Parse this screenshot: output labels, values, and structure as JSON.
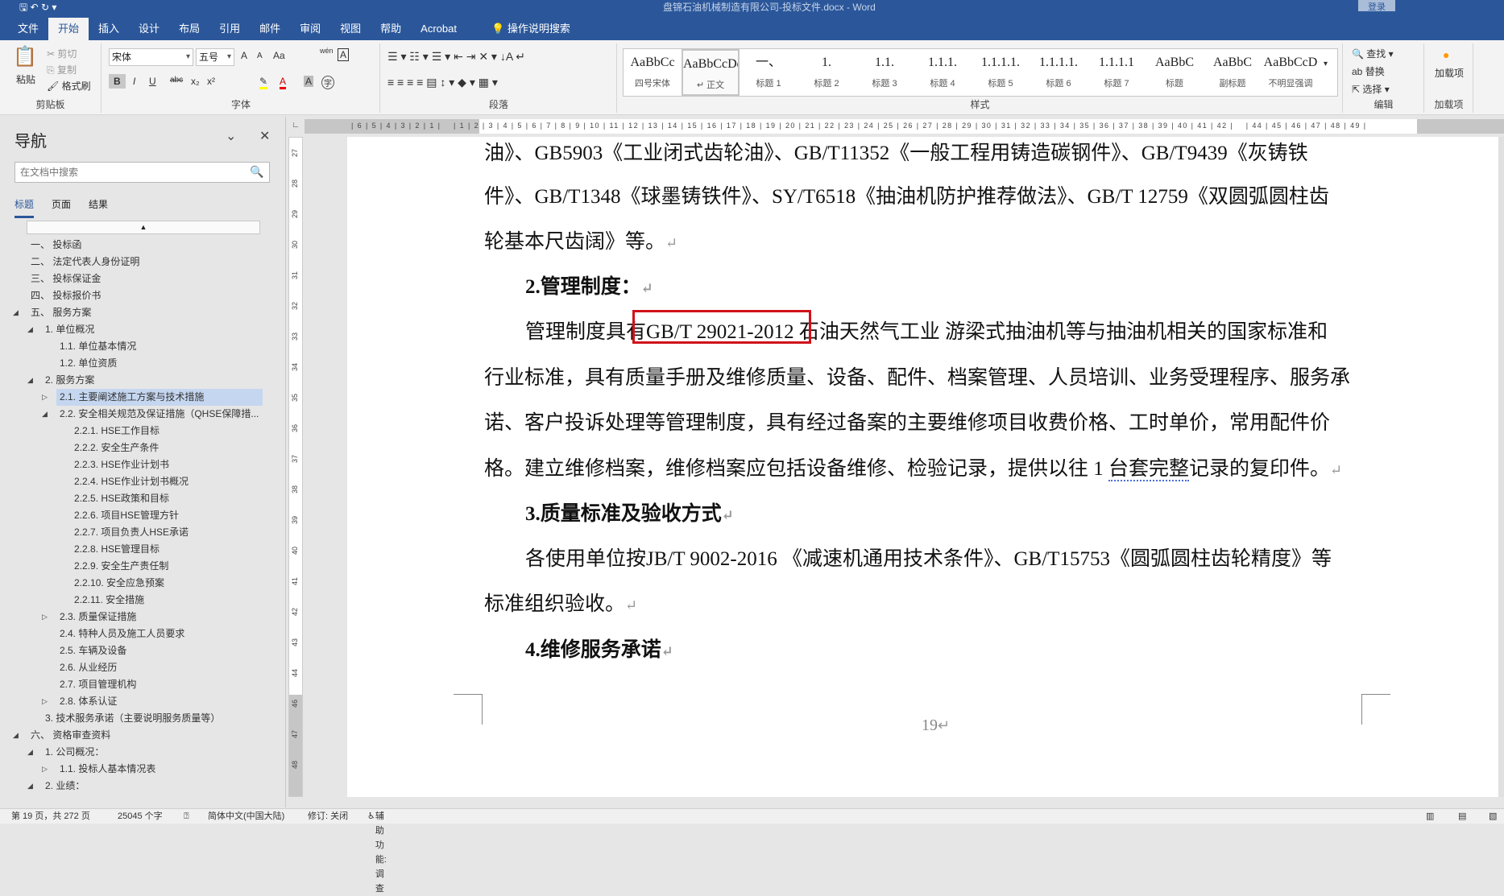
{
  "window": {
    "title": "盘锦石油机械制造有限公司-投标文件.docx  -  Word",
    "login": "登录"
  },
  "tabs": [
    "文件",
    "开始",
    "插入",
    "设计",
    "布局",
    "引用",
    "邮件",
    "审阅",
    "视图",
    "帮助",
    "Acrobat"
  ],
  "tell_me": "操作说明搜索",
  "ribbon": {
    "clipboard": {
      "label": "剪贴板",
      "paste": "粘贴",
      "cut": "剪切",
      "copy": "复制",
      "format_painter": "格式刷"
    },
    "font": {
      "label": "字体",
      "font_name": "宋体",
      "font_size": "五号",
      "bold": "B",
      "italic": "I",
      "underline": "U",
      "strike": "abc",
      "sub": "x₂",
      "sup": "x²",
      "case": "Aa",
      "grow": "A",
      "shrink": "A",
      "pinyin": "wén",
      "char_border": "A",
      "shade": "A",
      "enclose": "字"
    },
    "paragraph": {
      "label": "段落"
    },
    "styles": {
      "label": "样式",
      "items": [
        {
          "preview": "AaBbCc",
          "name": "四号宋体"
        },
        {
          "preview": "AaBbCcDdE",
          "name": "↵ 正文"
        },
        {
          "preview": "一、",
          "name": "标题 1"
        },
        {
          "preview": "1.",
          "name": "标题 2"
        },
        {
          "preview": "1.1.",
          "name": "标题 3"
        },
        {
          "preview": "1.1.1.",
          "name": "标题 4"
        },
        {
          "preview": "1.1.1.1.",
          "name": "标题 5"
        },
        {
          "preview": "1.1.1.1.",
          "name": "标题 6"
        },
        {
          "preview": "1.1.1.1",
          "name": "标题 7"
        },
        {
          "preview": "AaBbC",
          "name": "标题"
        },
        {
          "preview": "AaBbC",
          "name": "副标题"
        },
        {
          "preview": "AaBbCcD",
          "name": "不明显强调"
        }
      ]
    },
    "editing": {
      "label": "编辑",
      "find": "查找",
      "replace": "替换",
      "select": "选择"
    },
    "addins": {
      "label": "加载项",
      "button": "加载项"
    }
  },
  "nav": {
    "title": "导航",
    "search_placeholder": "在文档中搜索",
    "tabs": [
      "标题",
      "页面",
      "结果"
    ],
    "items": [
      {
        "t": "一、  投标函",
        "lv": 0,
        "tw": ""
      },
      {
        "t": "二、  法定代表人身份证明",
        "lv": 0,
        "tw": ""
      },
      {
        "t": "三、  投标保证金",
        "lv": 0,
        "tw": ""
      },
      {
        "t": "四、  投标报价书",
        "lv": 0,
        "tw": ""
      },
      {
        "t": "五、  服务方案",
        "lv": 0,
        "tw": "open"
      },
      {
        "t": "1. 单位概况",
        "lv": 1,
        "tw": "open"
      },
      {
        "t": "1.1. 单位基本情况",
        "lv": 2,
        "tw": ""
      },
      {
        "t": "1.2. 单位资质",
        "lv": 2,
        "tw": ""
      },
      {
        "t": "2. 服务方案",
        "lv": 1,
        "tw": "open"
      },
      {
        "t": "2.1. 主要阐述施工方案与技术措施",
        "lv": 2,
        "tw": "closed",
        "hl": true
      },
      {
        "t": "2.2. 安全相关规范及保证措施（QHSE保障措...",
        "lv": 2,
        "tw": "open"
      },
      {
        "t": "2.2.1. HSE工作目标",
        "lv": 3,
        "tw": ""
      },
      {
        "t": "2.2.2. 安全生产条件",
        "lv": 3,
        "tw": ""
      },
      {
        "t": "2.2.3. HSE作业计划书",
        "lv": 3,
        "tw": ""
      },
      {
        "t": "2.2.4. HSE作业计划书概况",
        "lv": 3,
        "tw": ""
      },
      {
        "t": "2.2.5. HSE政策和目标",
        "lv": 3,
        "tw": ""
      },
      {
        "t": "2.2.6. 项目HSE管理方针",
        "lv": 3,
        "tw": ""
      },
      {
        "t": "2.2.7. 项目负责人HSE承诺",
        "lv": 3,
        "tw": ""
      },
      {
        "t": "2.2.8. HSE管理目标",
        "lv": 3,
        "tw": ""
      },
      {
        "t": "2.2.9. 安全生产责任制",
        "lv": 3,
        "tw": ""
      },
      {
        "t": "2.2.10. 安全应急预案",
        "lv": 3,
        "tw": ""
      },
      {
        "t": "2.2.11. 安全措施",
        "lv": 3,
        "tw": ""
      },
      {
        "t": "2.3. 质量保证措施",
        "lv": 2,
        "tw": "closed"
      },
      {
        "t": "2.4. 特种人员及施工人员要求",
        "lv": 2,
        "tw": ""
      },
      {
        "t": "2.5. 车辆及设备",
        "lv": 2,
        "tw": ""
      },
      {
        "t": "2.6. 从业经历",
        "lv": 2,
        "tw": ""
      },
      {
        "t": "2.7. 项目管理机构",
        "lv": 2,
        "tw": ""
      },
      {
        "t": "2.8. 体系认证",
        "lv": 2,
        "tw": "closed"
      },
      {
        "t": "3. 技术服务承诺（主要说明服务质量等）",
        "lv": 1,
        "tw": ""
      },
      {
        "t": "六、  资格审查资料",
        "lv": 0,
        "tw": "open"
      },
      {
        "t": "1. 公司概况：",
        "lv": 1,
        "tw": "open"
      },
      {
        "t": "1.1. 投标人基本情况表",
        "lv": 2,
        "tw": "closed"
      },
      {
        "t": "2. 业绩：",
        "lv": 1,
        "tw": "open"
      }
    ]
  },
  "ruler": {
    "h": "| 6 | 5 | 4 | 3 | 2 | 1 |    | 1 | 2 | 3 | 4 | 5 | 6 | 7 | 8 | 9 | 10 | 11 | 12 | 13 | 14 | 15 | 16 | 17 | 18 | 19 | 20 | 21 | 22 | 23 | 24 | 25 | 26 | 27 | 28 | 29 | 30 | 31 | 32 | 33 | 34 | 35 | 36 | 37 | 38 | 39 | 40 | 41 | 42 |    | 44 | 45 | 46 | 47 | 48 | 49 |",
    "v": [
      "27",
      "28",
      "29",
      "30",
      "31",
      "32",
      "33",
      "34",
      "35",
      "36",
      "37",
      "38",
      "39",
      "40",
      "41",
      "42",
      "43",
      "44",
      "46",
      "47",
      "48"
    ]
  },
  "document": {
    "l1": "油》、GB5903《工业闭式齿轮油》、GB/T11352《一般工程用铸造碳钢件》、GB/T9439《灰铸铁",
    "l2": "件》、GB/T1348《球墨铸铁件》、SY/T6518《抽油机防护推荐做法》、GB/T 12759《双圆弧圆柱齿",
    "l3": "轮基本尺齿阔》等。",
    "h2": "2.管理制度：",
    "l5a": "管理制度具有",
    "l5b": "GB/T 29021-2012 ",
    "l5c": "石油天然气工业 游梁式抽油机等与抽油机相关的国家标准和",
    "l6": "行业标准，具有质量手册及维修质量、设备、配件、档案管理、人员培训、业务受理程序、服务承",
    "l7": "诺、客户投诉处理等管理制度，具有经过备案的主要维修项目收费价格、工时单价，常用配件价",
    "l8a": "格。建立维修档案，维修档案应包括设备维修、检验记录，提供以往 1 ",
    "l8b": "台套完整",
    "l8c": "记录的复印件。",
    "h3": "3.质量标准及验收方式",
    "l10": "各使用单位按JB/T 9002-2016 《减速机通用技术条件》、GB/T15753《圆弧圆柱齿轮精度》等",
    "l11": "标准组织验收。",
    "h4": "4.维修服务承诺",
    "page_number": "19",
    "para_mark": "↵"
  },
  "status": {
    "page": "第 19 页，共 272 页",
    "words": "25045 个字",
    "language": "简体中文(中国大陆)",
    "track": "修订: 关闭",
    "accessibility": "辅助功能: 调查"
  }
}
